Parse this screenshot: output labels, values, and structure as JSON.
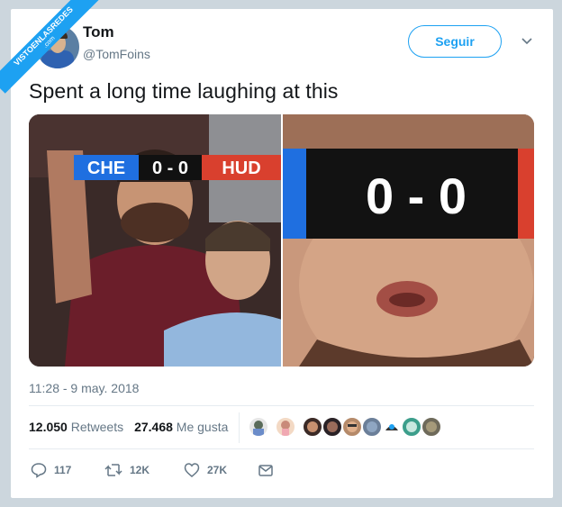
{
  "watermark": {
    "line1": "VISTOENLASREDES",
    "line2": ".com"
  },
  "author": {
    "name": "Tom",
    "handle": "@TomFoins",
    "avatar_icon": "profile-avatar"
  },
  "follow_label": "Seguir",
  "tweet_text": "Spent a long time laughing at this",
  "media": {
    "scoreboard": {
      "home": "CHE",
      "score": "0 - 0",
      "away": "HUD"
    },
    "zoom_score": "0 - 0"
  },
  "timestamp": "11:28 - 9 may. 2018",
  "stats": {
    "retweets_count": "12.050",
    "retweets_label": "Retweets",
    "likes_count": "27.468",
    "likes_label": "Me gusta"
  },
  "actions": {
    "replies": "117",
    "retweets": "12K",
    "likes": "27K"
  },
  "colors": {
    "accent": "#1da1f2",
    "muted": "#657786",
    "text": "#14171a"
  }
}
